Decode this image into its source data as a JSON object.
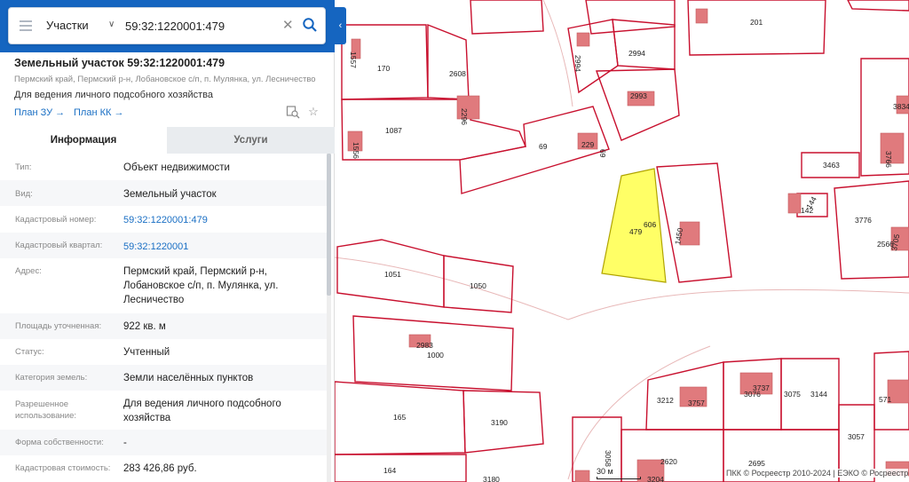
{
  "search": {
    "type_label": "Участки",
    "query": "59:32:1220001:479"
  },
  "parcel": {
    "title": "Земельный участок 59:32:1220001:479",
    "address_short": "Пермский край, Пермский р-н, Лобановское с/п, п. Мулянка, ул. Лесничество",
    "purpose": "Для ведения личного подсобного хозяйства",
    "link_zu": "План ЗУ →",
    "link_kk": "План КК →"
  },
  "tabs": {
    "info": "Информация",
    "services": "Услуги"
  },
  "details": [
    {
      "key": "Тип:",
      "value": "Объект недвижимости"
    },
    {
      "key": "Вид:",
      "value": "Земельный участок"
    },
    {
      "key": "Кадастровый номер:",
      "value": "59:32:1220001:479"
    },
    {
      "key": "Кадастровый квартал:",
      "value": "59:32:1220001"
    },
    {
      "key": "Адрес:",
      "value": "Пермский край, Пермский р-н, Лобановское с/п, п. Мулянка, ул. Лесничество"
    },
    {
      "key": "Площадь уточненная:",
      "value": "922 кв. м"
    },
    {
      "key": "Статус:",
      "value": "Учтенный"
    },
    {
      "key": "Категория земель:",
      "value": "Земли населённых пунктов"
    },
    {
      "key": "Разрешенное использование:",
      "value": "Для ведения личного подсобного хозяйства"
    },
    {
      "key": "Форма собственности:",
      "value": "-"
    },
    {
      "key": "Кадастровая стоимость:",
      "value": "283 426,86 руб."
    }
  ],
  "map": {
    "scale_label": "30 м",
    "attribution": "ПКК © Росреестр 2010-2024 | ЕЭКО © Росреестр",
    "labels": [
      "170",
      "2608",
      "201",
      "2994",
      "2994",
      "2993",
      "2296",
      "1557",
      "1087",
      "1556",
      "69",
      "229",
      "69",
      "3463",
      "3834",
      "3766",
      "479",
      "606",
      "1450",
      "142",
      "144",
      "3776",
      "2566",
      "3705",
      "1051",
      "1050",
      "2983",
      "1000",
      "3737",
      "3076",
      "3075",
      "3144",
      "3212",
      "3757",
      "571",
      "165",
      "3190",
      "3058",
      "2620",
      "3057",
      "2695",
      "164",
      "3180",
      "3204"
    ],
    "highlight_color": "#ffff66",
    "border_color": "#c8102e"
  }
}
